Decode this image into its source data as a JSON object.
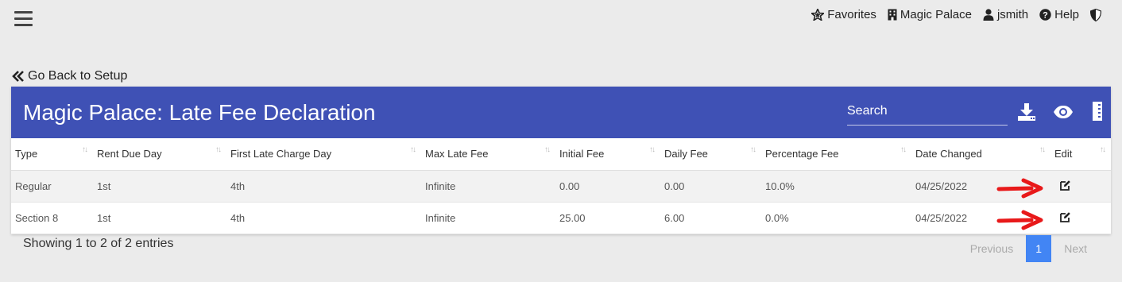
{
  "nav": {
    "favorites": "Favorites",
    "property": "Magic Palace",
    "user": "jsmith",
    "help": "Help"
  },
  "back_link": "Go Back to Setup",
  "card": {
    "title": "Magic Palace: Late Fee Declaration",
    "search_placeholder": "Search"
  },
  "table": {
    "columns": [
      "Type",
      "Rent Due Day",
      "First Late Charge Day",
      "Max Late Fee",
      "Initial Fee",
      "Daily Fee",
      "Percentage Fee",
      "Date Changed",
      "Edit"
    ],
    "rows": [
      {
        "type": "Regular",
        "rent_due_day": "1st",
        "first_late_charge_day": "4th",
        "max_late_fee": "Infinite",
        "initial_fee": "0.00",
        "daily_fee": "0.00",
        "percentage_fee": "10.0%",
        "date_changed": "04/25/2022"
      },
      {
        "type": "Section 8",
        "rent_due_day": "1st",
        "first_late_charge_day": "4th",
        "max_late_fee": "Infinite",
        "initial_fee": "25.00",
        "daily_fee": "6.00",
        "percentage_fee": "0.0%",
        "date_changed": "04/25/2022"
      }
    ]
  },
  "footer": {
    "info": "Showing 1 to 2 of 2 entries",
    "previous": "Previous",
    "page": "1",
    "next": "Next"
  },
  "colors": {
    "header_bg": "#3f51b5",
    "page_active": "#4285f4",
    "annotation_arrow": "#e8191a"
  }
}
